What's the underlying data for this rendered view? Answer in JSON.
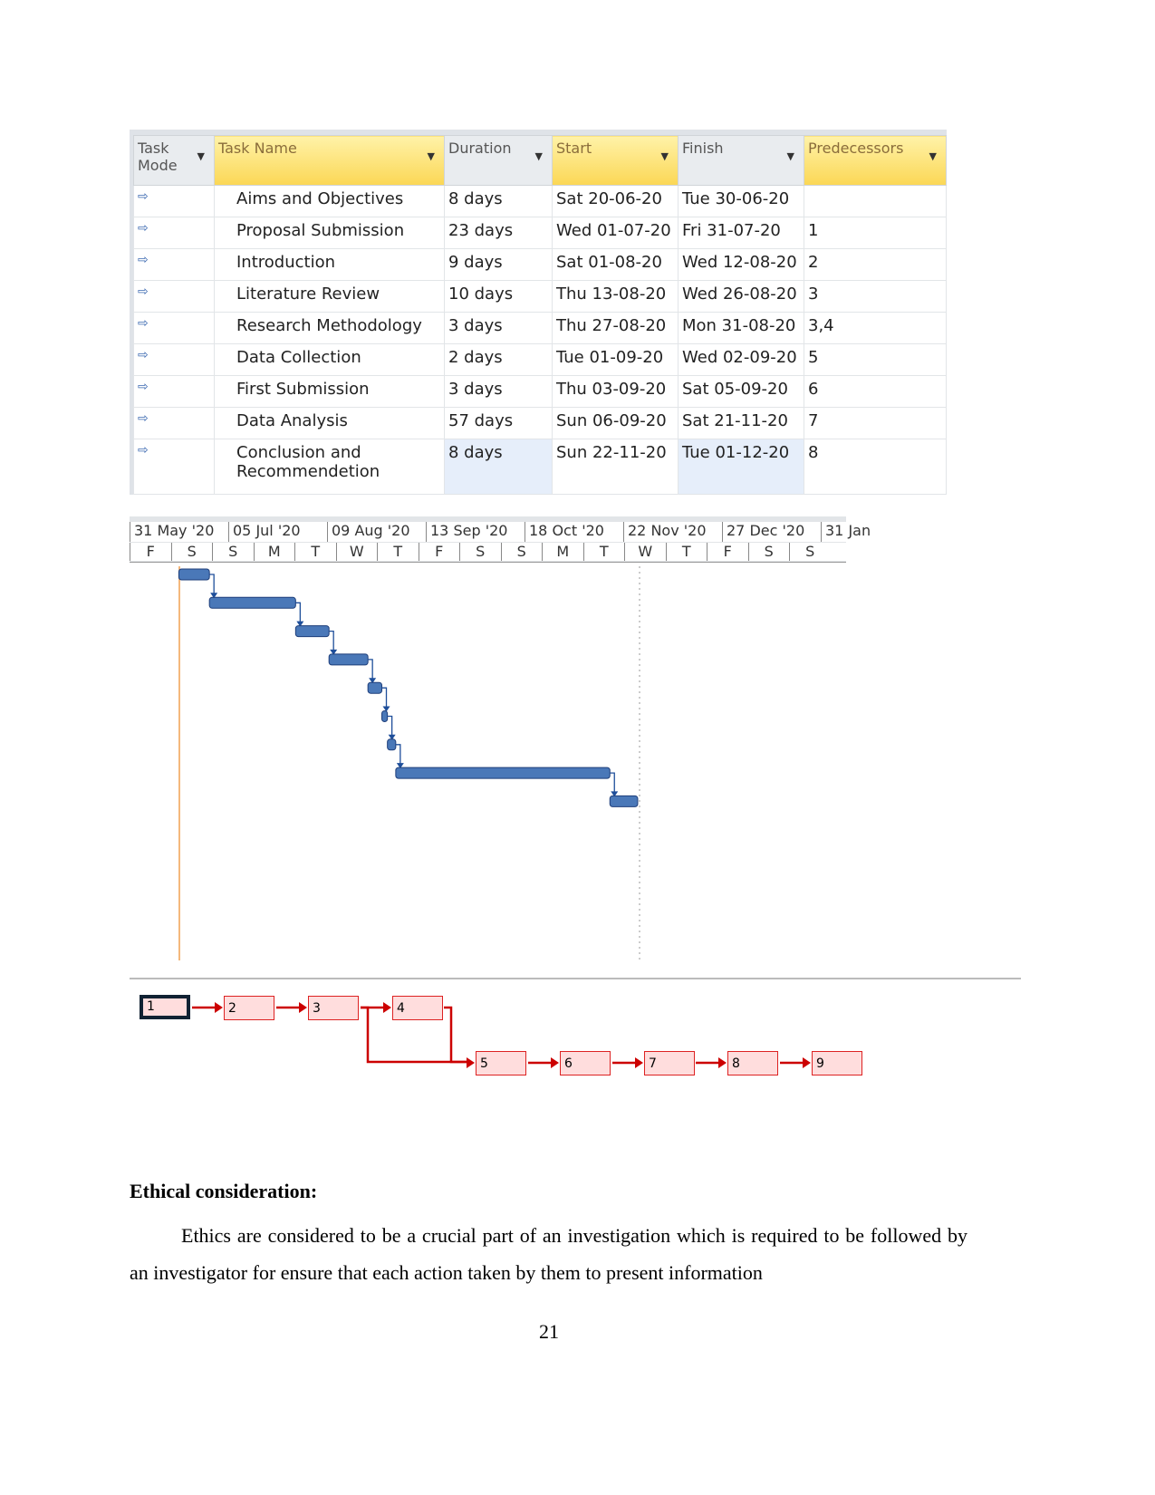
{
  "table": {
    "headers": {
      "mode": "Task Mode",
      "name": "Task Name",
      "duration": "Duration",
      "start": "Start",
      "finish": "Finish",
      "pred": "Predecessors"
    },
    "rows": [
      {
        "name": "Aims and Objectives",
        "duration": "8 days",
        "start": "Sat 20-06-20",
        "finish": "Tue 30-06-20",
        "pred": ""
      },
      {
        "name": "Proposal Submission",
        "duration": "23 days",
        "start": "Wed 01-07-20",
        "finish": "Fri 31-07-20",
        "pred": "1"
      },
      {
        "name": "Introduction",
        "duration": "9 days",
        "start": "Sat 01-08-20",
        "finish": "Wed 12-08-20",
        "pred": "2"
      },
      {
        "name": "Literature Review",
        "duration": "10 days",
        "start": "Thu 13-08-20",
        "finish": "Wed 26-08-20",
        "pred": "3"
      },
      {
        "name": "Research Methodology",
        "duration": "3 days",
        "start": "Thu 27-08-20",
        "finish": "Mon 31-08-20",
        "pred": "3,4"
      },
      {
        "name": "Data Collection",
        "duration": "2 days",
        "start": "Tue 01-09-20",
        "finish": "Wed 02-09-20",
        "pred": "5"
      },
      {
        "name": "First Submission",
        "duration": "3 days",
        "start": "Thu 03-09-20",
        "finish": "Sat 05-09-20",
        "pred": "6"
      },
      {
        "name": "Data Analysis",
        "duration": "57 days",
        "start": "Sun 06-09-20",
        "finish": "Sat 21-11-20",
        "pred": "7"
      },
      {
        "name": "Conclusion and Recommendetion",
        "duration": "8 days",
        "start": "Sun 22-11-20",
        "finish": "Tue 01-12-20",
        "pred": "8"
      }
    ]
  },
  "gantt": {
    "periods": [
      "31 May '20",
      "05 Jul '20",
      "09 Aug '20",
      "13 Sep '20",
      "18 Oct '20",
      "22 Nov '20",
      "27 Dec '20",
      "31 Jan"
    ],
    "days": [
      "F",
      "S",
      "S",
      "M",
      "T",
      "W",
      "T",
      "F",
      "S",
      "S",
      "M",
      "T",
      "W",
      "T",
      "F",
      "S",
      "S"
    ],
    "bar_color": "#4a78b8"
  },
  "network": {
    "nodes": [
      "1",
      "2",
      "3",
      "4",
      "5",
      "6",
      "7",
      "8",
      "9"
    ],
    "link_color": "#cc0000"
  },
  "section": {
    "heading": "Ethical consideration:",
    "text": "Ethics are considered to be a crucial part of an investigation which is required to be followed by an investigator for ensure that each action taken by them to present information"
  },
  "page_number": "21"
}
